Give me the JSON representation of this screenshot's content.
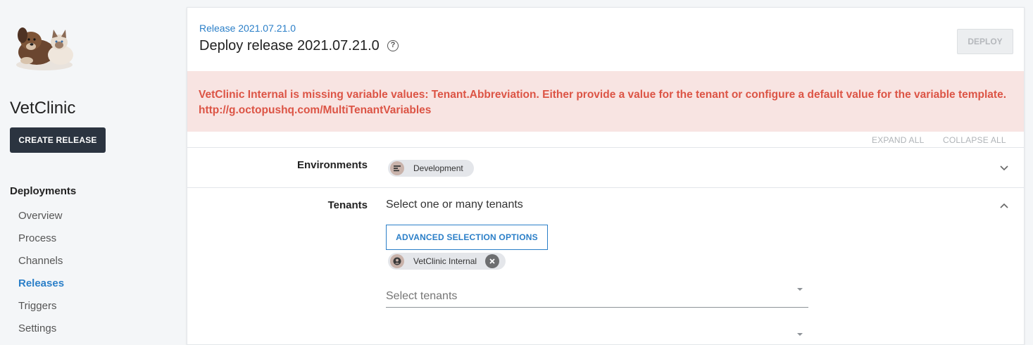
{
  "sidebar": {
    "project_name": "VetClinic",
    "create_release_label": "CREATE RELEASE",
    "nav_heading": "Deployments",
    "nav_items": [
      {
        "label": "Overview"
      },
      {
        "label": "Process"
      },
      {
        "label": "Channels"
      },
      {
        "label": "Releases",
        "active": true
      },
      {
        "label": "Triggers"
      },
      {
        "label": "Settings"
      }
    ]
  },
  "header": {
    "breadcrumb": "Release 2021.07.21.0",
    "title": "Deploy release 2021.07.21.0",
    "help_icon": "?",
    "deploy_label": "DEPLOY"
  },
  "error": {
    "message": "VetClinic Internal is missing variable values: Tenant.Abbreviation. Either provide a value for the tenant or configure a default value for the variable template. http://g.octopushq.com/MultiTenantVariables"
  },
  "toolbar": {
    "expand_all": "EXPAND ALL",
    "collapse_all": "COLLAPSE ALL"
  },
  "environments": {
    "label": "Environments",
    "chip_label": "Development",
    "chip_icon": "environment-icon"
  },
  "tenants": {
    "label": "Tenants",
    "hint": "Select one or many tenants",
    "advanced_label": "ADVANCED SELECTION OPTIONS",
    "selected_chip": "VetClinic Internal",
    "chip_icon": "tenant-icon",
    "select_placeholder": "Select tenants"
  },
  "colors": {
    "accent": "#2b7fc8",
    "error_text": "#dc5445",
    "error_bg": "#f8e4e2",
    "dark_button": "#2b3440"
  }
}
